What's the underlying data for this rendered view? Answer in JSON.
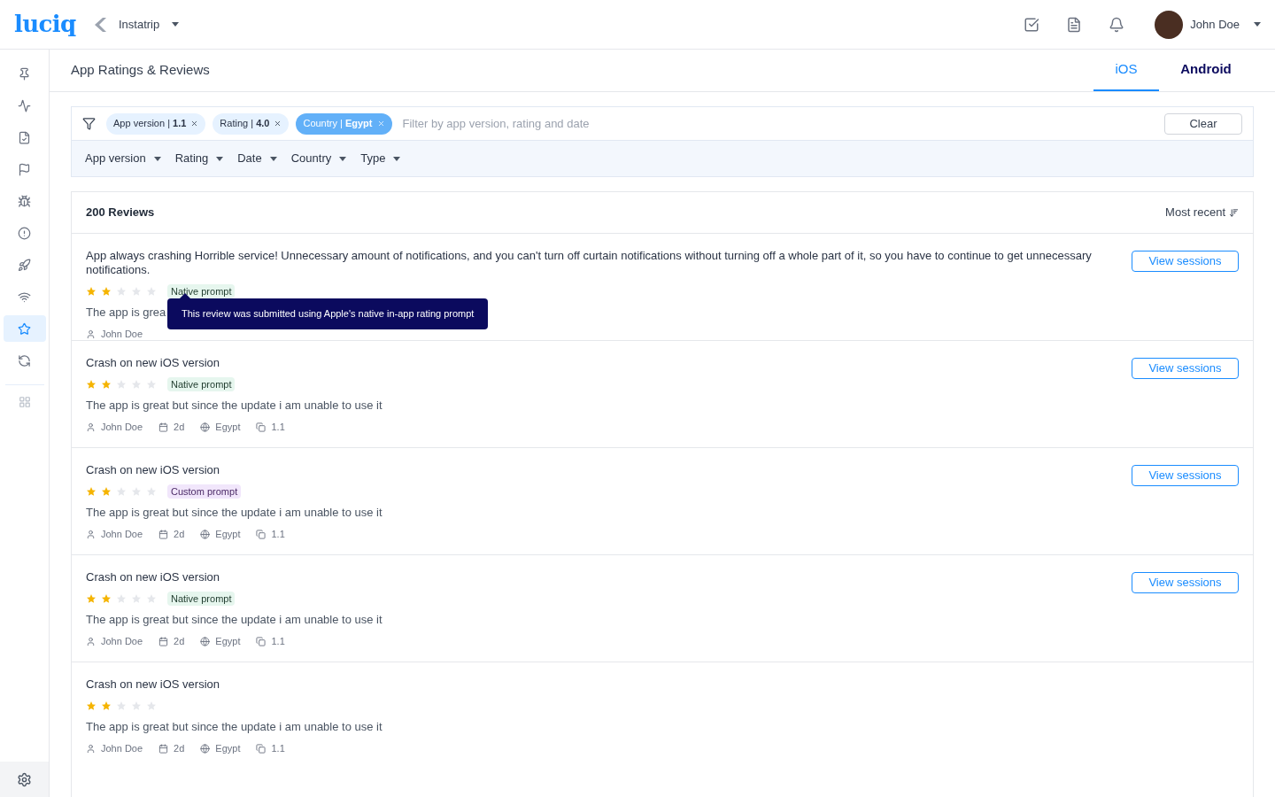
{
  "header": {
    "logo": "luciq",
    "app": "Instatrip",
    "user": "John Doe"
  },
  "sidebar": {
    "items": [
      {
        "selected": false
      },
      {
        "selected": false
      },
      {
        "selected": false
      },
      {
        "selected": false
      },
      {
        "selected": false
      },
      {
        "selected": false
      },
      {
        "selected": false
      },
      {
        "selected": false
      },
      {
        "selected": true
      },
      {
        "selected": false
      }
    ]
  },
  "page": {
    "title": "App Ratings & Reviews",
    "tabs": [
      {
        "label": "iOS",
        "selected": true
      },
      {
        "label": "Android",
        "selected": false
      }
    ]
  },
  "filter": {
    "chips": [
      {
        "label": "App version | ",
        "value": "1.1",
        "selected": false
      },
      {
        "label": "Rating | ",
        "value": "4.0",
        "selected": false
      },
      {
        "label": "Country | ",
        "value": "Egypt",
        "selected": true
      }
    ],
    "placeholder": "Filter by app version, rating and date",
    "clear": "Clear",
    "dropdowns": [
      "App version",
      "Rating",
      "Date",
      "Country",
      "Type"
    ]
  },
  "reviews": {
    "count": "200 Reviews",
    "sort": "Most recent",
    "items": [
      {
        "title": "App always crashing Horrible service! Unnecessary amount of notifications, and you can't turn off curtain notifications without turning off a whole part of it, so you have to continue to get unnecessary notifications.",
        "stars": 2,
        "tag": {
          "label": "Native prompt",
          "kind": "native"
        },
        "body": "The app is grea",
        "author": "John Doe",
        "tooltip": "This review was submitted using Apple's native in-app rating prompt",
        "button": "View sessions"
      },
      {
        "title": "Crash on new iOS version",
        "stars": 2,
        "tag": {
          "label": "Native prompt",
          "kind": "native"
        },
        "body": "The app is great but since the update i am unable to use it",
        "author": "John Doe",
        "date": "2d",
        "country": "Egypt",
        "version": "1.1",
        "button": "View sessions"
      },
      {
        "title": "Crash on new iOS version",
        "stars": 2,
        "tag": {
          "label": "Custom prompt",
          "kind": "custom"
        },
        "body": "The app is great but since the update i am unable to use it",
        "author": "John Doe",
        "date": "2d",
        "country": "Egypt",
        "version": "1.1",
        "button": "View sessions"
      },
      {
        "title": "Crash on new iOS version",
        "stars": 2,
        "tag": {
          "label": "Native prompt",
          "kind": "native"
        },
        "body": "The app is great but since the update i am unable to use it",
        "author": "John Doe",
        "date": "2d",
        "country": "Egypt",
        "version": "1.1",
        "button": "View sessions"
      },
      {
        "title": "Crash on new iOS version",
        "stars": 2,
        "body": "The app is great but since the update i am unable to use it",
        "author": "John Doe",
        "date": "2d",
        "country": "Egypt",
        "version": "1.1"
      }
    ]
  }
}
